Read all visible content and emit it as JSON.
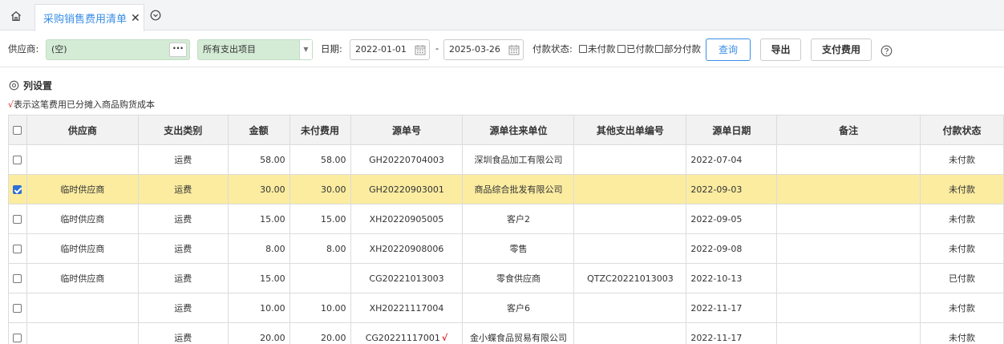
{
  "tab": {
    "label": "采购销售费用清单",
    "close": "✕"
  },
  "filters": {
    "supplier_label": "供应商:",
    "supplier_value": "(空)",
    "supplier_more": "···",
    "category_value": "所有支出项目",
    "date_label": "日期:",
    "date_from": "2022-01-01",
    "date_sep": "-",
    "date_to": "2025-03-26",
    "pay_status_label": "付款状态:",
    "status_options": [
      "未付款",
      "已付款",
      "部分付款"
    ]
  },
  "buttons": {
    "query": "查询",
    "export": "导出",
    "pay": "支付费用"
  },
  "column_settings": "列设置",
  "note": {
    "mark": "√",
    "text": "表示这笔费用已分摊入商品购货成本"
  },
  "table": {
    "headers": [
      "供应商",
      "支出类别",
      "金额",
      "未付费用",
      "源单号",
      "源单往来单位",
      "其他支出单编号",
      "源单日期",
      "备注",
      "付款状态"
    ],
    "rows": [
      {
        "checked": false,
        "supplier": "",
        "category": "运费",
        "amount": "58.00",
        "unpaid": "58.00",
        "src_no": "GH20220704003",
        "src_party": "深圳食品加工有限公司",
        "other_no": "",
        "date": "2022-07-04",
        "remark": "",
        "status": "未付款"
      },
      {
        "checked": true,
        "supplier": "临时供应商",
        "category": "运费",
        "amount": "30.00",
        "unpaid": "30.00",
        "src_no": "GH20220903001",
        "src_party": "商品综合批发有限公司",
        "other_no": "",
        "date": "2022-09-03",
        "remark": "",
        "status": "未付款"
      },
      {
        "checked": false,
        "supplier": "临时供应商",
        "category": "运费",
        "amount": "15.00",
        "unpaid": "15.00",
        "src_no": "XH20220905005",
        "src_party": "客户2",
        "other_no": "",
        "date": "2022-09-05",
        "remark": "",
        "status": "未付款"
      },
      {
        "checked": false,
        "supplier": "临时供应商",
        "category": "运费",
        "amount": "8.00",
        "unpaid": "8.00",
        "src_no": "XH20220908006",
        "src_party": "零售",
        "other_no": "",
        "date": "2022-09-08",
        "remark": "",
        "status": "未付款"
      },
      {
        "checked": false,
        "supplier": "临时供应商",
        "category": "运费",
        "amount": "15.00",
        "unpaid": "",
        "src_no": "CG20221013003",
        "src_party": "零食供应商",
        "other_no": "QTZC20221013003",
        "date": "2022-10-13",
        "remark": "",
        "status": "已付款"
      },
      {
        "checked": false,
        "supplier": "",
        "category": "运费",
        "amount": "10.00",
        "unpaid": "10.00",
        "src_no": "XH20221117004",
        "src_party": "客户6",
        "other_no": "",
        "date": "2022-11-17",
        "remark": "",
        "status": "未付款"
      },
      {
        "checked": false,
        "supplier": "",
        "category": "运费",
        "amount": "20.00",
        "unpaid": "20.00",
        "src_no": "CG20221117001",
        "src_mark": "√",
        "src_party": "金小蝶食品贸易有限公司",
        "other_no": "",
        "date": "2022-11-17",
        "remark": "",
        "status": "未付款"
      }
    ]
  }
}
